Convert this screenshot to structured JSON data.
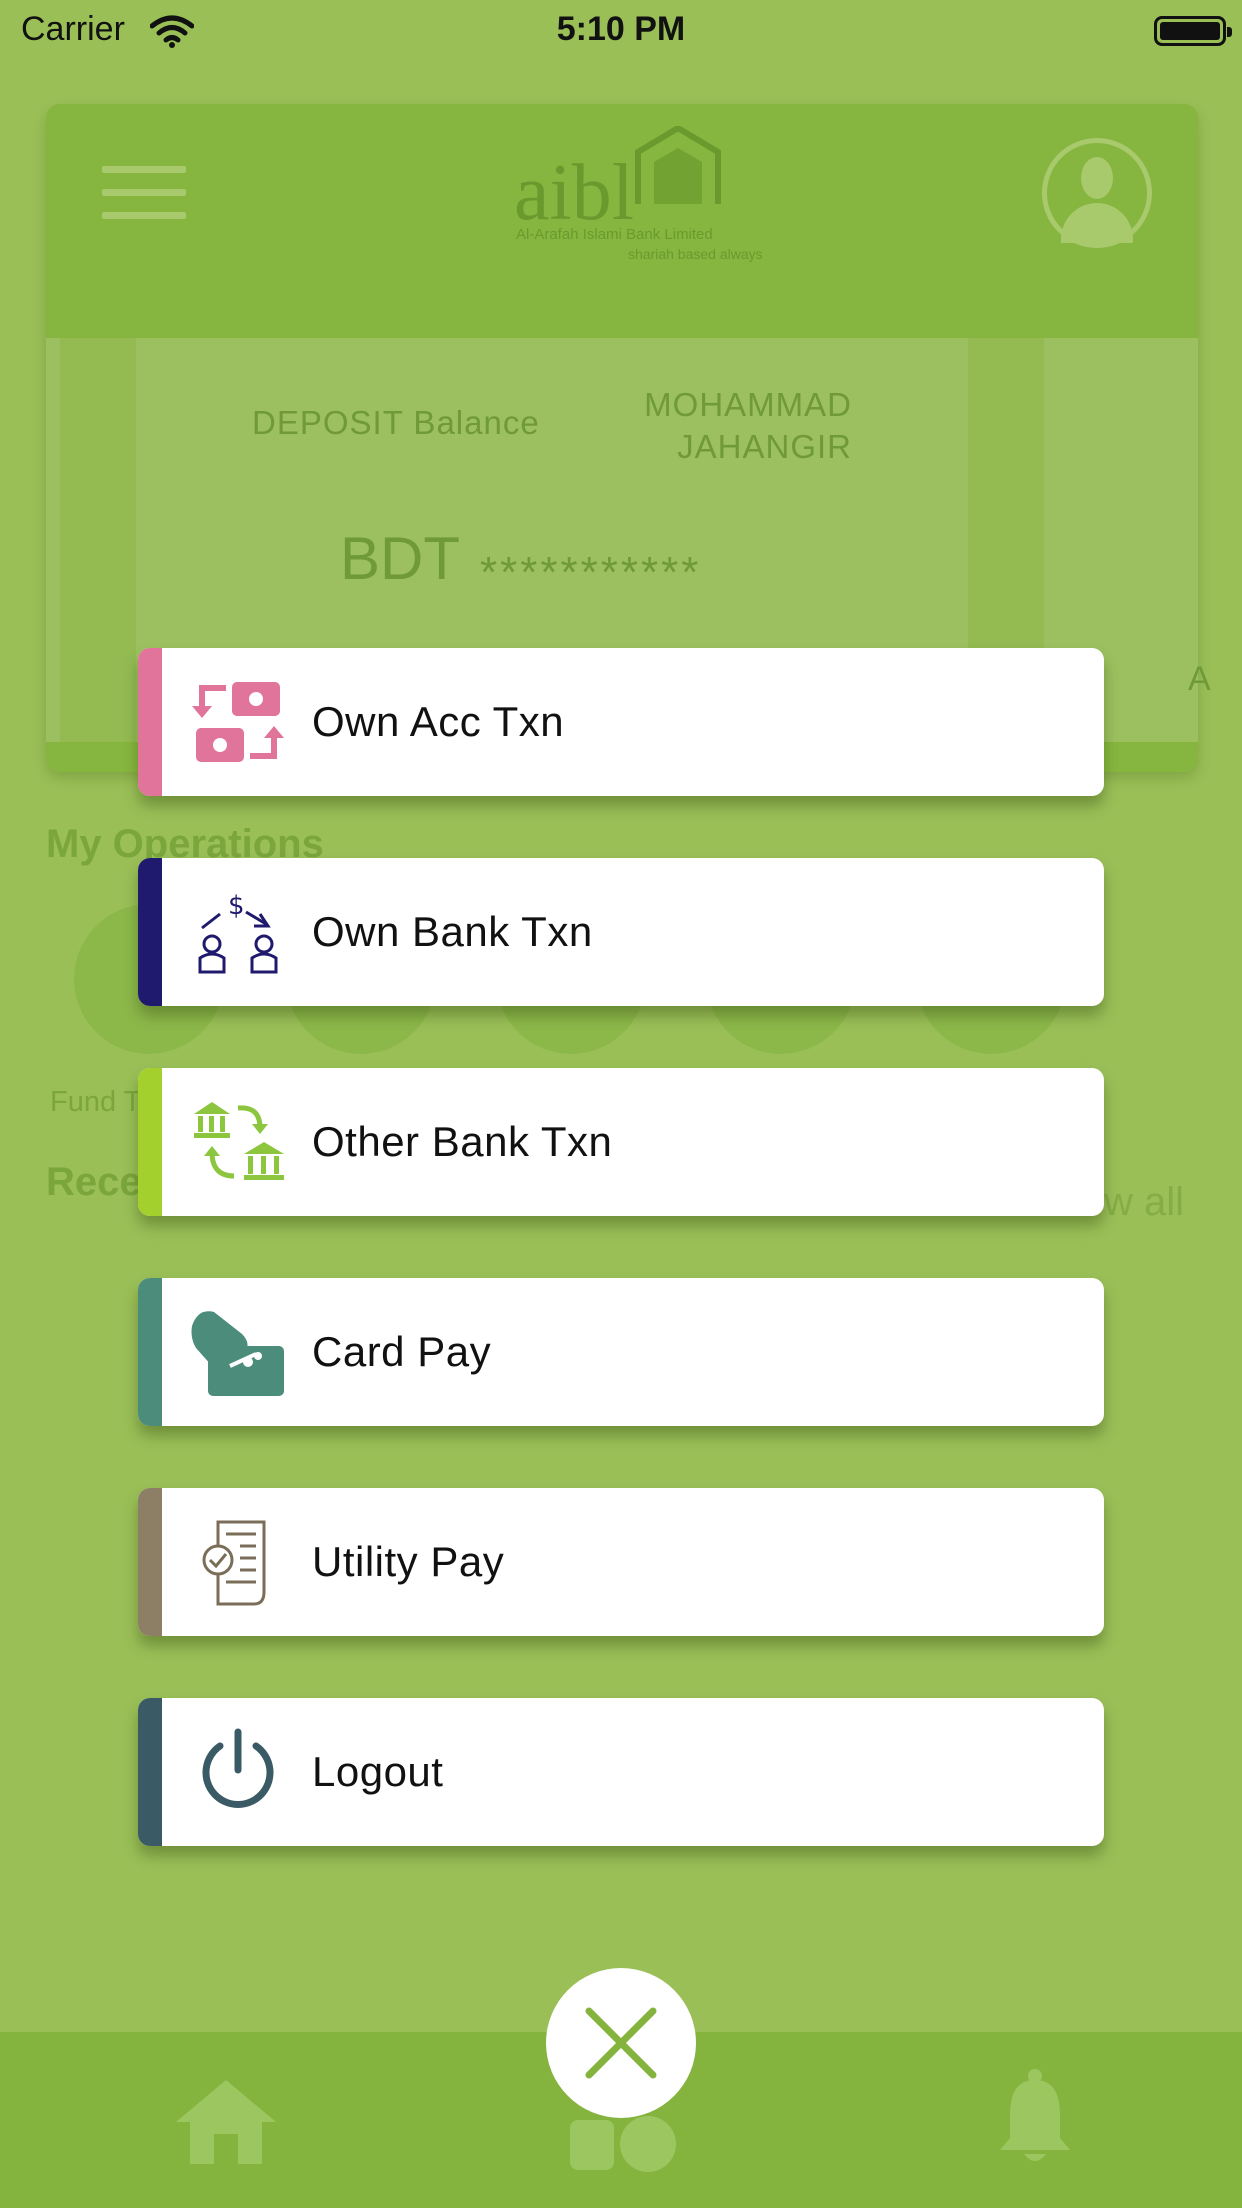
{
  "status_bar": {
    "carrier": "Carrier",
    "time": "5:10 PM"
  },
  "header": {
    "logo_text": "aibl",
    "logo_subtitle": "Al-Arafah Islami Bank Limited",
    "logo_tagline": "shariah based always"
  },
  "balance_card": {
    "title": "DEPOSIT Balance",
    "holder_name_line1": "MOHAMMAD",
    "holder_name_line2": "JAHANGIR",
    "currency": "BDT",
    "masked_amount": "***********"
  },
  "sections": {
    "my_operations": "My Operations",
    "first_operation_label": "Fund T",
    "recent": "Rece",
    "view_all": "w all"
  },
  "menu": {
    "items": [
      {
        "label": "Own Acc Txn",
        "accent": "#e0749b",
        "icon": "money-exchange-icon"
      },
      {
        "label": "Own Bank Txn",
        "accent": "#1f1a6e",
        "icon": "person-transfer-icon"
      },
      {
        "label": "Other Bank Txn",
        "accent": "#a3d02d",
        "icon": "bank-transfer-icon"
      },
      {
        "label": "Card Pay",
        "accent": "#4b8c7a",
        "icon": "card-pay-icon"
      },
      {
        "label": "Utility Pay",
        "accent": "#8d7f66",
        "icon": "utility-bill-icon"
      },
      {
        "label": "Logout",
        "accent": "#3a5a66",
        "icon": "power-icon"
      }
    ],
    "close_icon": "close-icon"
  },
  "colors": {
    "background": "#9abf57",
    "tabbar": "#84b43e",
    "close_x": "#84b43e"
  }
}
